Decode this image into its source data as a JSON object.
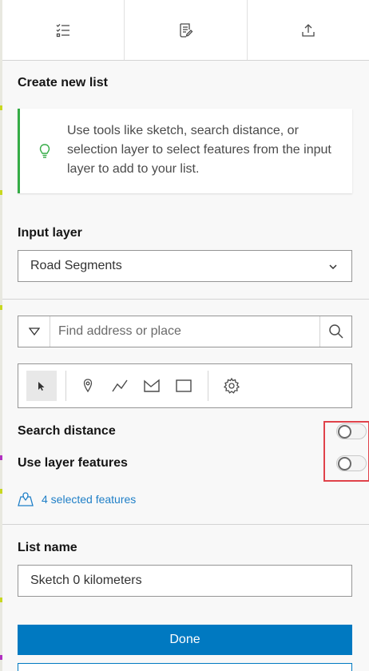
{
  "tabs": [
    {
      "name": "checklist-tab",
      "icon": "checklist-icon"
    },
    {
      "name": "report-tab",
      "icon": "edit-document-icon"
    },
    {
      "name": "export-tab",
      "icon": "upload-icon"
    }
  ],
  "create_section": {
    "title": "Create new list",
    "notice_icon": "lightbulb-icon",
    "notice_text": "Use tools like sketch, search distance, or selection layer to select features from the input layer to add to your list."
  },
  "input_layer": {
    "label": "Input layer",
    "selected": "Road Segments"
  },
  "search": {
    "placeholder": "Find address or place",
    "value": ""
  },
  "sketch_tools": [
    "select-arrow-icon",
    "point-pin-icon",
    "polyline-icon",
    "polygon-icon",
    "rectangle-icon",
    "settings-gear-icon"
  ],
  "options": {
    "search_distance_label": "Search distance",
    "search_distance_on": false,
    "use_layer_features_label": "Use layer features",
    "use_layer_features_on": false
  },
  "selected_features_text": "4 selected features",
  "list_name": {
    "label": "List name",
    "value": "Sketch 0 kilometers"
  },
  "actions": {
    "done_label": "Done",
    "cancel_label": ""
  },
  "colors": {
    "accent": "#0079c1",
    "notice_border": "#35ac46",
    "link": "#1f7fc7",
    "highlight": "#e0424a"
  }
}
